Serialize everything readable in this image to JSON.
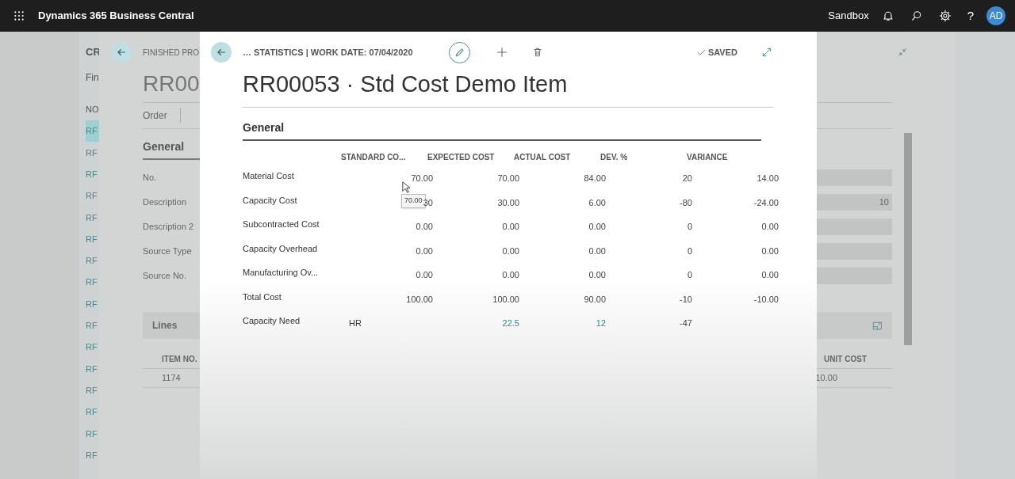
{
  "app_bar": {
    "title": "Dynamics 365 Business Central",
    "environment": "Sandbox",
    "avatar": "AD",
    "help": "?"
  },
  "list_page": {
    "title": "CR",
    "subtitle": "Fin",
    "column": "NO",
    "rows": [
      {
        "text": "RF",
        "selected": true
      },
      {
        "text": "RF",
        "selected": false
      },
      {
        "text": "RF",
        "selected": false
      },
      {
        "text": "RF",
        "selected": false
      },
      {
        "text": "RF",
        "selected": false
      },
      {
        "text": "RF",
        "selected": false
      },
      {
        "text": "RF",
        "selected": false
      },
      {
        "text": "RF",
        "selected": false
      },
      {
        "text": "RF",
        "selected": false
      },
      {
        "text": "RF",
        "selected": false
      },
      {
        "text": "RF",
        "selected": false
      },
      {
        "text": "RF",
        "selected": false
      },
      {
        "text": "RF",
        "selected": false
      },
      {
        "text": "RF",
        "selected": false
      },
      {
        "text": "RF",
        "selected": false
      },
      {
        "text": "RF",
        "selected": false
      }
    ]
  },
  "order_page": {
    "breadcrumb": "FINISHED PRO",
    "title": "RR00",
    "action": "Order",
    "section": "General",
    "fields": [
      {
        "label": "No."
      },
      {
        "label": "Description",
        "value": "10"
      },
      {
        "label": "Description 2"
      },
      {
        "label": "Source Type"
      },
      {
        "label": "Source No."
      }
    ],
    "lines": {
      "title": "Lines",
      "columns": [
        "ITEM NO.",
        "UNIT COST"
      ],
      "row": [
        "1174",
        "10.00"
      ]
    }
  },
  "dialog": {
    "breadcrumb": "… STATISTICS | WORK DATE: 07/04/2020",
    "status": "SAVED",
    "title": "RR00053 · Std Cost Demo Item",
    "section": "General",
    "columns": [
      "STANDARD CO...",
      "EXPECTED COST",
      "ACTUAL COST",
      "DEV. %",
      "VARIANCE"
    ],
    "rows": [
      {
        "label": "Material Cost",
        "cells": [
          {
            "text": "70.00",
            "link": false
          },
          {
            "text": "70.00",
            "link": false
          },
          {
            "text": "84.00",
            "link": false
          },
          {
            "text": "20",
            "link": false
          },
          {
            "text": "14.00",
            "link": false
          }
        ]
      },
      {
        "label": "Capacity Cost",
        "cells": [
          {
            "text": "30",
            "link": false
          },
          {
            "text": "30.00",
            "link": false
          },
          {
            "text": "6.00",
            "link": false
          },
          {
            "text": "-80",
            "link": false
          },
          {
            "text": "-24.00",
            "link": false
          }
        ]
      },
      {
        "label": "Subcontracted Cost",
        "cells": [
          {
            "text": "0.00",
            "link": false
          },
          {
            "text": "0.00",
            "link": false
          },
          {
            "text": "0.00",
            "link": false
          },
          {
            "text": "0",
            "link": false
          },
          {
            "text": "0.00",
            "link": false
          }
        ]
      },
      {
        "label": "Capacity Overhead",
        "cells": [
          {
            "text": "0.00",
            "link": false
          },
          {
            "text": "0.00",
            "link": false
          },
          {
            "text": "0.00",
            "link": false
          },
          {
            "text": "0",
            "link": false
          },
          {
            "text": "0.00",
            "link": false
          }
        ]
      },
      {
        "label": "Manufacturing Ov...",
        "cells": [
          {
            "text": "0.00",
            "link": false
          },
          {
            "text": "0.00",
            "link": false
          },
          {
            "text": "0.00",
            "link": false
          },
          {
            "text": "0",
            "link": false
          },
          {
            "text": "0.00",
            "link": false
          }
        ]
      },
      {
        "label": "Total Cost",
        "cells": [
          {
            "text": "100.00",
            "link": false
          },
          {
            "text": "100.00",
            "link": false
          },
          {
            "text": "90.00",
            "link": false
          },
          {
            "text": "-10",
            "link": false
          },
          {
            "text": "-10.00",
            "link": false
          }
        ]
      },
      {
        "label": "Capacity Need",
        "unit": "HR",
        "cells": [
          null,
          {
            "text": "22.5",
            "link": true
          },
          {
            "text": "12",
            "link": true
          },
          {
            "text": "-47",
            "link": false
          },
          null
        ]
      }
    ],
    "tooltip": "70.00"
  }
}
